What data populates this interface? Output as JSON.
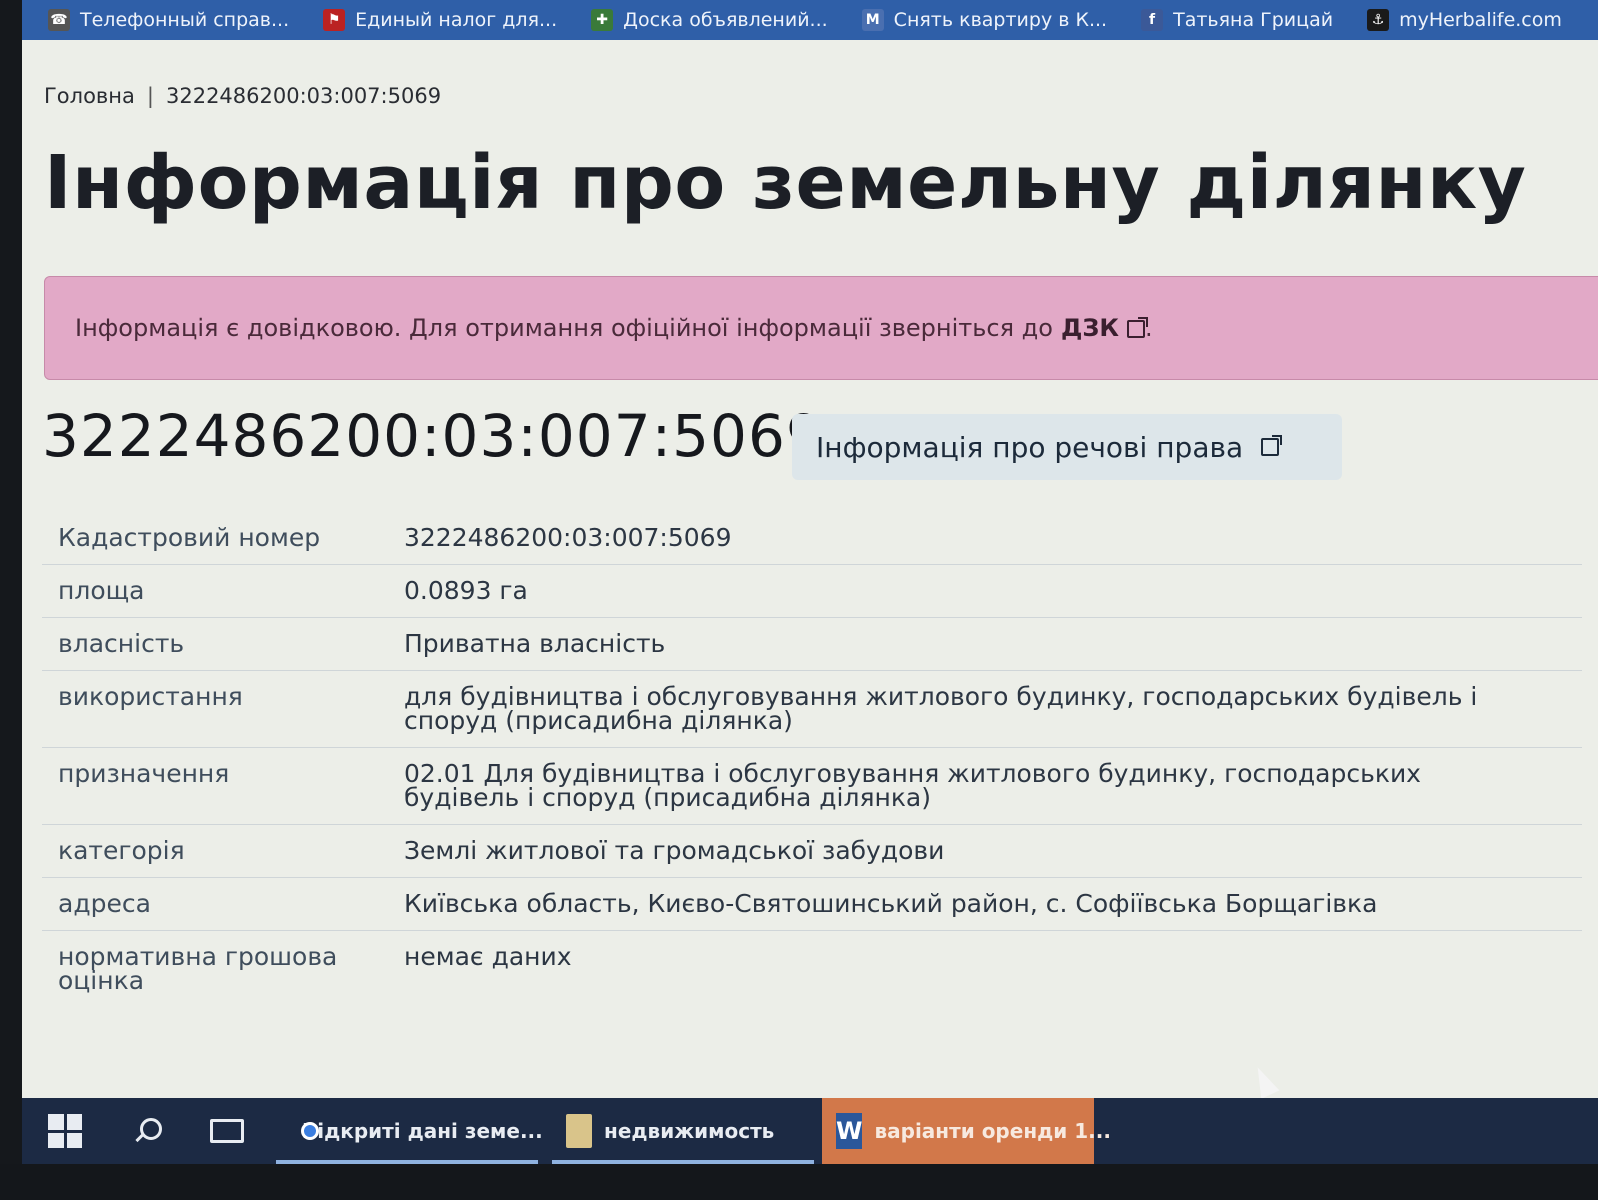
{
  "bookmarks": [
    {
      "label": "Телефонный справ...",
      "icon": "bookmark-icon"
    },
    {
      "label": "Единый налог для...",
      "icon": "flag-icon"
    },
    {
      "label": "Доска объявлений...",
      "icon": "board-icon"
    },
    {
      "label": "Снять квартиру в К...",
      "icon": "m-icon"
    },
    {
      "label": "Татьяна Грицай",
      "icon": "facebook-icon"
    },
    {
      "label": "myHerbalife.com",
      "icon": "herbalife-icon"
    }
  ],
  "breadcrumb": {
    "home": "Головна",
    "separator": "|",
    "current": "3222486200:03:007:5069"
  },
  "page_title": "Інформація про земельну ділянку",
  "alert": {
    "text": "Інформація є довідковою. Для отримання офіційної інформації зверніться до",
    "link": "ДЗК",
    "suffix": "."
  },
  "parcel": {
    "number": "3222486200:03:007:5069",
    "rights_button": "Інформація про речові права"
  },
  "info_rows": [
    {
      "key": "Кадастровий номер",
      "value": "3222486200:03:007:5069"
    },
    {
      "key": "площа",
      "value": "0.0893 га"
    },
    {
      "key": "власність",
      "value": "Приватна власність"
    },
    {
      "key": "використання",
      "value": "для будівництва і обслуговування житлового будинку, господарських будівель і споруд (присадибна ділянка)"
    },
    {
      "key": "призначення",
      "value": "02.01 Для будівництва і обслуговування житлового будинку, господарських будівель і споруд (присадибна ділянка)"
    },
    {
      "key": "категорія",
      "value": "Землі житлової та громадської забудови"
    },
    {
      "key": "адреса",
      "value": "Київська область, Києво-Святошинський район, с. Софіївська Борщагівка"
    },
    {
      "key": "нормативна грошова оцінка",
      "value": "немає даних"
    }
  ],
  "taskbar": {
    "apps": [
      {
        "label": "Відкриті дані земе...",
        "icon": "chrome-icon"
      },
      {
        "label": "недвижимость",
        "icon": "folder-icon"
      },
      {
        "label": "варіанти оренди 1...",
        "icon": "word-icon"
      }
    ]
  },
  "colors": {
    "alert_bg": "#e2a9c7",
    "bookmarks_bg": "#2f5fa8",
    "taskbar_bg": "#1c2a44"
  }
}
